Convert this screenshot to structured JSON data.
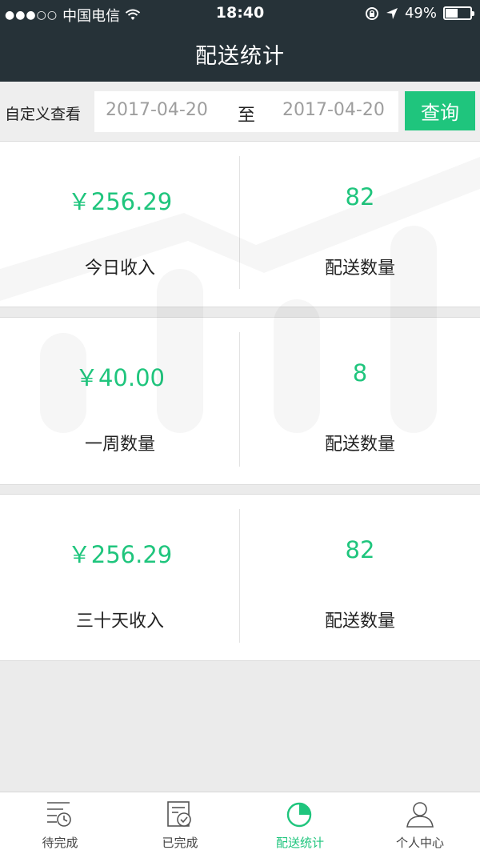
{
  "status_bar": {
    "signal": "●●●○○",
    "carrier": "中国电信",
    "time": "18:40",
    "battery": "49%",
    "battery_level": 0.49
  },
  "header": {
    "title": "配送统计"
  },
  "filter": {
    "label": "自定义查看",
    "start_date": "2017-04-20",
    "separator": "至",
    "end_date": "2017-04-20",
    "search_label": "查询"
  },
  "stats": [
    {
      "value": "￥256.29",
      "caption": "今日收入",
      "count": "82",
      "count_caption": "配送数量"
    },
    {
      "value": "￥40.00",
      "caption": "一周数量",
      "count": "8",
      "count_caption": "配送数量"
    },
    {
      "value": "￥256.29",
      "caption": "三十天收入",
      "count": "82",
      "count_caption": "配送数量"
    }
  ],
  "tabs": [
    {
      "label": "待完成",
      "icon": "pending-list-icon"
    },
    {
      "label": "已完成",
      "icon": "completed-list-icon"
    },
    {
      "label": "配送统计",
      "icon": "pie-chart-icon"
    },
    {
      "label": "个人中心",
      "icon": "user-icon"
    }
  ],
  "colors": {
    "accent": "#1fc57d",
    "header_bg": "#263238"
  }
}
